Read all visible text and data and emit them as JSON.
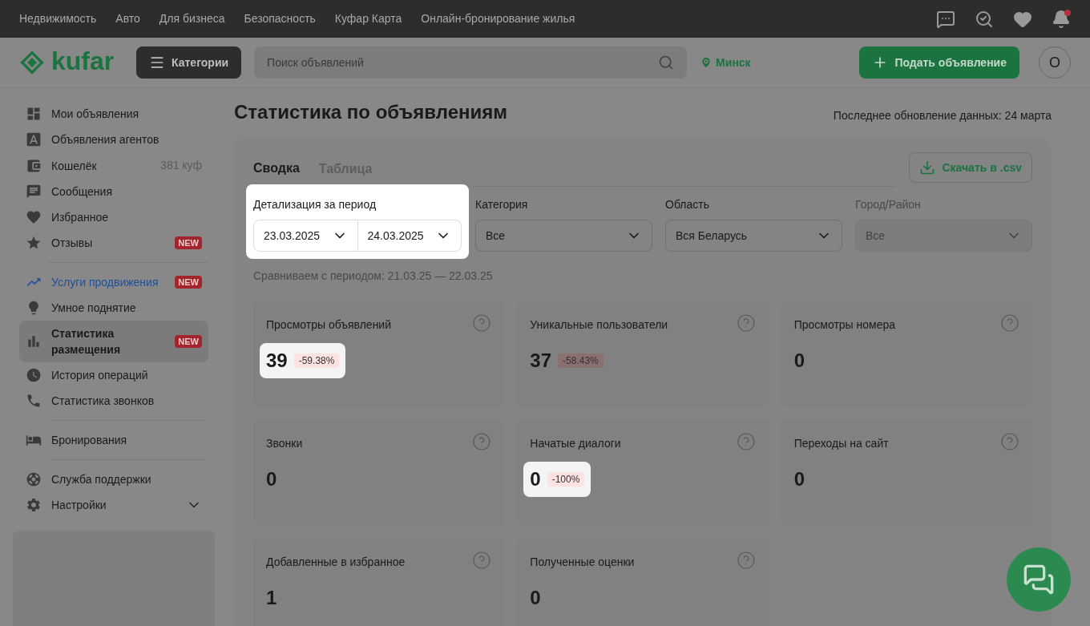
{
  "top_nav": {
    "links": [
      "Недвижимость",
      "Авто",
      "Для бизнеса",
      "Безопасность",
      "Куфар Карта",
      "Онлайн-бронирование жилья"
    ],
    "notification_unread": true
  },
  "header": {
    "logo": "kufar",
    "categories_button": "Категории",
    "search": {
      "placeholder": "Поиск объявлений"
    },
    "location": "Минск",
    "post_button": "Подать объявление",
    "avatar": "О"
  },
  "sidebar": {
    "groups": [
      [
        {
          "label": "Мои объявления",
          "kind": "item",
          "selected": false
        },
        {
          "label": "Объявления агентов",
          "kind": "item",
          "selected": false
        },
        {
          "label": "Кошелёк",
          "kind": "item",
          "selected": false,
          "meta": "381 куф"
        },
        {
          "label": "Сообщения",
          "kind": "item",
          "selected": false
        },
        {
          "label": "Избранное",
          "kind": "item",
          "selected": false
        },
        {
          "label": "Отзывы",
          "kind": "item",
          "selected": false,
          "badge": "NEW"
        }
      ],
      [
        {
          "label": "Услуги продвижения",
          "kind": "link",
          "selected": false,
          "badge": "NEW"
        },
        {
          "label": "Умное поднятие",
          "kind": "item",
          "selected": false
        },
        {
          "label": "Статистика размещения",
          "kind": "item",
          "selected": true,
          "badge": "NEW"
        },
        {
          "label": "История операций",
          "kind": "item",
          "selected": false
        },
        {
          "label": "Статистика звонков",
          "kind": "item",
          "selected": false
        }
      ],
      [
        {
          "label": "Бронирования",
          "kind": "item",
          "selected": false
        }
      ],
      [
        {
          "label": "Служба поддержки",
          "kind": "item",
          "selected": false
        },
        {
          "label": "Настройки",
          "kind": "expandable",
          "selected": false,
          "expanded": false
        }
      ]
    ]
  },
  "main": {
    "title": "Статистика по объявлениям",
    "updated": "Последнее обновление данных: 24 марта",
    "tabs": [
      {
        "label": "Сводка",
        "selected": true
      },
      {
        "label": "Таблица",
        "selected": false
      }
    ],
    "download_button": "Скачать в .csv",
    "filters": [
      {
        "label": "Детализация за период",
        "values": [
          "23.03.2025",
          "24.03.2025"
        ],
        "disabled": false,
        "highlighted": true
      },
      {
        "label": "Категория",
        "values": [
          "Все"
        ],
        "disabled": false,
        "highlighted": false
      },
      {
        "label": "Область",
        "values": [
          "Вся Беларусь"
        ],
        "disabled": false,
        "highlighted": false
      },
      {
        "label": "Город/Район",
        "values": [
          "Все"
        ],
        "disabled": true,
        "highlighted": false
      }
    ],
    "comparison": "Сравниваем с периодом: 21.03.25 — 22.03.25",
    "cards": [
      {
        "title": "Просмотры объявлений",
        "value": "39",
        "delta": "-59.38%",
        "highlighted": true
      },
      {
        "title": "Уникальные пользователи",
        "value": "37",
        "delta": "-58.43%",
        "highlighted": false
      },
      {
        "title": "Просмотры номера",
        "value": "0",
        "highlighted": false
      },
      {
        "title": "Звонки",
        "value": "0",
        "highlighted": false
      },
      {
        "title": "Начатые диалоги",
        "value": "0",
        "delta": "-100%",
        "highlighted": true
      },
      {
        "title": "Переходы на сайт",
        "value": "0",
        "highlighted": false
      },
      {
        "title": "Добавленные в избранное",
        "value": "1",
        "highlighted": false
      },
      {
        "title": "Полученные оценки",
        "value": "0",
        "highlighted": false
      }
    ]
  }
}
